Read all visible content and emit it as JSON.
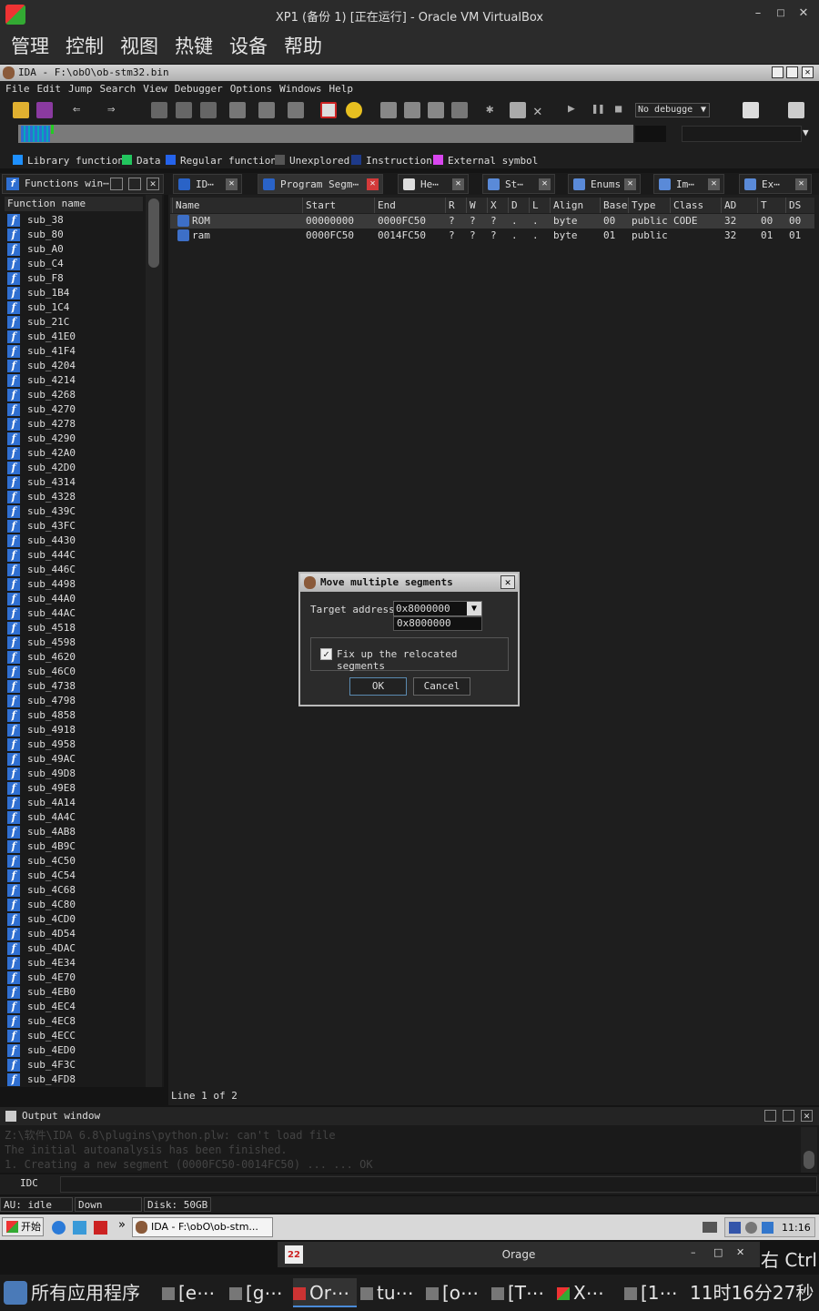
{
  "vbox": {
    "title": "XP1 (备份 1) [正在运行] - Oracle VM VirtualBox",
    "menu": [
      "管理",
      "控制",
      "视图",
      "热键",
      "设备",
      "帮助"
    ]
  },
  "ida": {
    "title": "IDA - F:\\obO\\ob-stm32.bin",
    "menu": [
      "File",
      "Edit",
      "Jump",
      "Search",
      "View",
      "Debugger",
      "Options",
      "Windows",
      "Help"
    ],
    "debugger_select": "No debugge",
    "legend": [
      {
        "label": "Library function",
        "color": "#1e90ff"
      },
      {
        "label": "Data",
        "color": "#22c55e"
      },
      {
        "label": "Regular function",
        "color": "#2563eb"
      },
      {
        "label": "Unexplored",
        "color": "#555555"
      },
      {
        "label": "Instruction",
        "color": "#1e3a8a"
      },
      {
        "label": "External symbol",
        "color": "#d946ef"
      }
    ]
  },
  "functions": {
    "title": "Functions win⋯",
    "column": "Function name",
    "items": [
      "sub_38",
      "sub_80",
      "sub_A0",
      "sub_C4",
      "sub_F8",
      "sub_1B4",
      "sub_1C4",
      "sub_21C",
      "sub_41E0",
      "sub_41F4",
      "sub_4204",
      "sub_4214",
      "sub_4268",
      "sub_4270",
      "sub_4278",
      "sub_4290",
      "sub_42A0",
      "sub_42D0",
      "sub_4314",
      "sub_4328",
      "sub_439C",
      "sub_43FC",
      "sub_4430",
      "sub_444C",
      "sub_446C",
      "sub_4498",
      "sub_44A0",
      "sub_44AC",
      "sub_4518",
      "sub_4598",
      "sub_4620",
      "sub_46C0",
      "sub_4738",
      "sub_4798",
      "sub_4858",
      "sub_4918",
      "sub_4958",
      "sub_49AC",
      "sub_49D8",
      "sub_49E8",
      "sub_4A14",
      "sub_4A4C",
      "sub_4AB8",
      "sub_4B9C",
      "sub_4C50",
      "sub_4C54",
      "sub_4C68",
      "sub_4C80",
      "sub_4CD0",
      "sub_4D54",
      "sub_4DAC",
      "sub_4E34",
      "sub_4E70",
      "sub_4EB0",
      "sub_4EC4",
      "sub_4EC8",
      "sub_4ECC",
      "sub_4ED0",
      "sub_4F3C",
      "sub_4FD8"
    ]
  },
  "tabs": [
    "ID⋯",
    "Program Segm⋯",
    "He⋯",
    "St⋯",
    "Enums",
    "Im⋯",
    "Ex⋯"
  ],
  "segments": {
    "columns": [
      "Name",
      "Start",
      "End",
      "R",
      "W",
      "X",
      "D",
      "L",
      "Align",
      "Base",
      "Type",
      "Class",
      "AD",
      "T",
      "DS"
    ],
    "rows": [
      [
        "ROM",
        "00000000",
        "0000FC50",
        "?",
        "?",
        "?",
        ".",
        ".",
        "byte",
        "00",
        "public",
        "CODE",
        "32",
        "00",
        "00"
      ],
      [
        "ram",
        "0000FC50",
        "0014FC50",
        "?",
        "?",
        "?",
        ".",
        ".",
        "byte",
        "01",
        "public",
        "",
        "32",
        "01",
        "01"
      ]
    ],
    "status": "Line 1 of 2"
  },
  "dialog": {
    "title": "Move multiple segments",
    "target_label": "Target address",
    "target_value": "0x8000000",
    "dropdown_option": "0x8000000",
    "checkbox_label": "Fix up the relocated segments",
    "checked": true,
    "ok": "OK",
    "cancel": "Cancel"
  },
  "output": {
    "title": "Output window",
    "lines": [
      "Z:\\软件\\IDA 6.8\\plugins\\python.plw: can't load file",
      "The initial autoanalysis has been finished.",
      "  1. Creating a new segment  (0000FC50-0014FC50) ... ... OK"
    ],
    "idc": "IDC"
  },
  "status": {
    "au_label": "AU:",
    "au": "idle",
    "direction": "Down",
    "disk": "Disk: 50GB"
  },
  "xp_taskbar": {
    "start": "开始",
    "task": "IDA - F:\\obO\\ob-stm...",
    "time": "11:16"
  },
  "orage": {
    "title": "Orage",
    "date_icon": "22",
    "right_key": "右 Ctrl"
  },
  "host_taskbar": {
    "apps_label": "所有应用程序",
    "items": [
      "[e⋯",
      "[g⋯",
      "Or⋯",
      "tu⋯",
      "[o⋯",
      "[T⋯",
      "X⋯",
      "[1⋯"
    ],
    "clock": "11时16分27秒"
  }
}
